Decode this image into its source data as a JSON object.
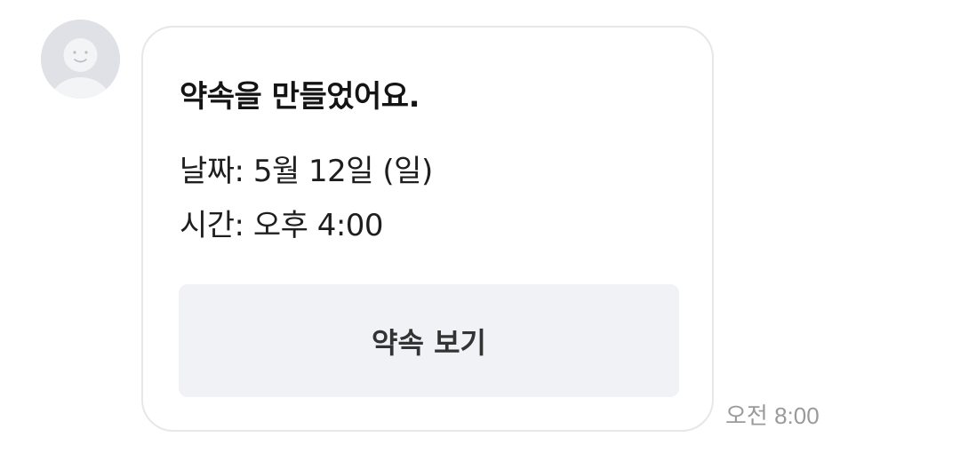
{
  "message": {
    "sender_avatar_icon": "default-profile-icon",
    "title": "약속을 만들었어요.",
    "date_line": "날짜: 5월 12일 (일)",
    "time_line": "시간: 오후 4:00",
    "button_label": "약속 보기",
    "timestamp": "오전 8:00"
  },
  "colors": {
    "avatar_bg": "#dfe1e6",
    "button_bg": "#f1f2f6",
    "bubble_border": "#e6e7ea",
    "timestamp_text": "#9a9a9a"
  }
}
